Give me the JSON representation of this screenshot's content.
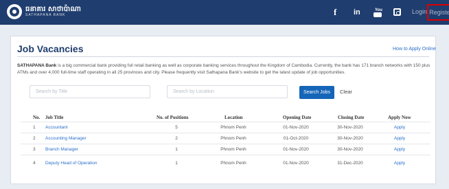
{
  "header": {
    "brand_name": "ធនាគារ សាថាប៉ាណា",
    "brand_sub": "SATHAPANA BANK",
    "social": {
      "facebook": "f",
      "linkedin": "in",
      "youtube": "You",
      "instagram": ""
    },
    "login_label": "Login",
    "register_label": "Register"
  },
  "main": {
    "title": "Job Vacancies",
    "how_to_apply": "How to Apply Online",
    "description_bank": "SATHAPANA Bank",
    "description_rest": " is a big commercial bank providing full retail banking as well as corporate banking services throughout the Kingdom of Cambodia. Currently, the bank has 171 branch networks with 150 plus ATMs and over 4,000 full-time staff operating in all 25 provinces and city. Please frequently visit Sathapana Bank's website to get the latest update of job opportunities.",
    "search_title_placeholder": "Search by Title",
    "search_location_placeholder": "Search by Location",
    "search_button": "Search Jobs",
    "clear_button": "Clear"
  },
  "table": {
    "headers": [
      "No.",
      "Job Title",
      "No. of Positions",
      "Location",
      "Opening Date",
      "Closing Date",
      "Apply Now"
    ],
    "rows": [
      {
        "no": "1",
        "title": "Accountant",
        "positions": "5",
        "location": "Phnom Penh",
        "opening": "01-Nov-2020",
        "closing": "30-Nov-2020",
        "apply": "Apply"
      },
      {
        "no": "2",
        "title": "Accounting Manager",
        "positions": "2",
        "location": "Phnom Penh",
        "opening": "01-Oct-2020",
        "closing": "30-Nov-2020",
        "apply": "Apply"
      },
      {
        "no": "3",
        "title": "Branch Manager",
        "positions": "1",
        "location": "Phnom Penh",
        "opening": "01-Nov-2020",
        "closing": "30-Nov-2020",
        "apply": "Apply"
      },
      {
        "no": "4",
        "title": "Deputy Head of Operation",
        "positions": "1",
        "location": "Phnom Penh",
        "opening": "01-Nov-2020",
        "closing": "31-Dec-2020",
        "apply": "Apply"
      }
    ]
  }
}
